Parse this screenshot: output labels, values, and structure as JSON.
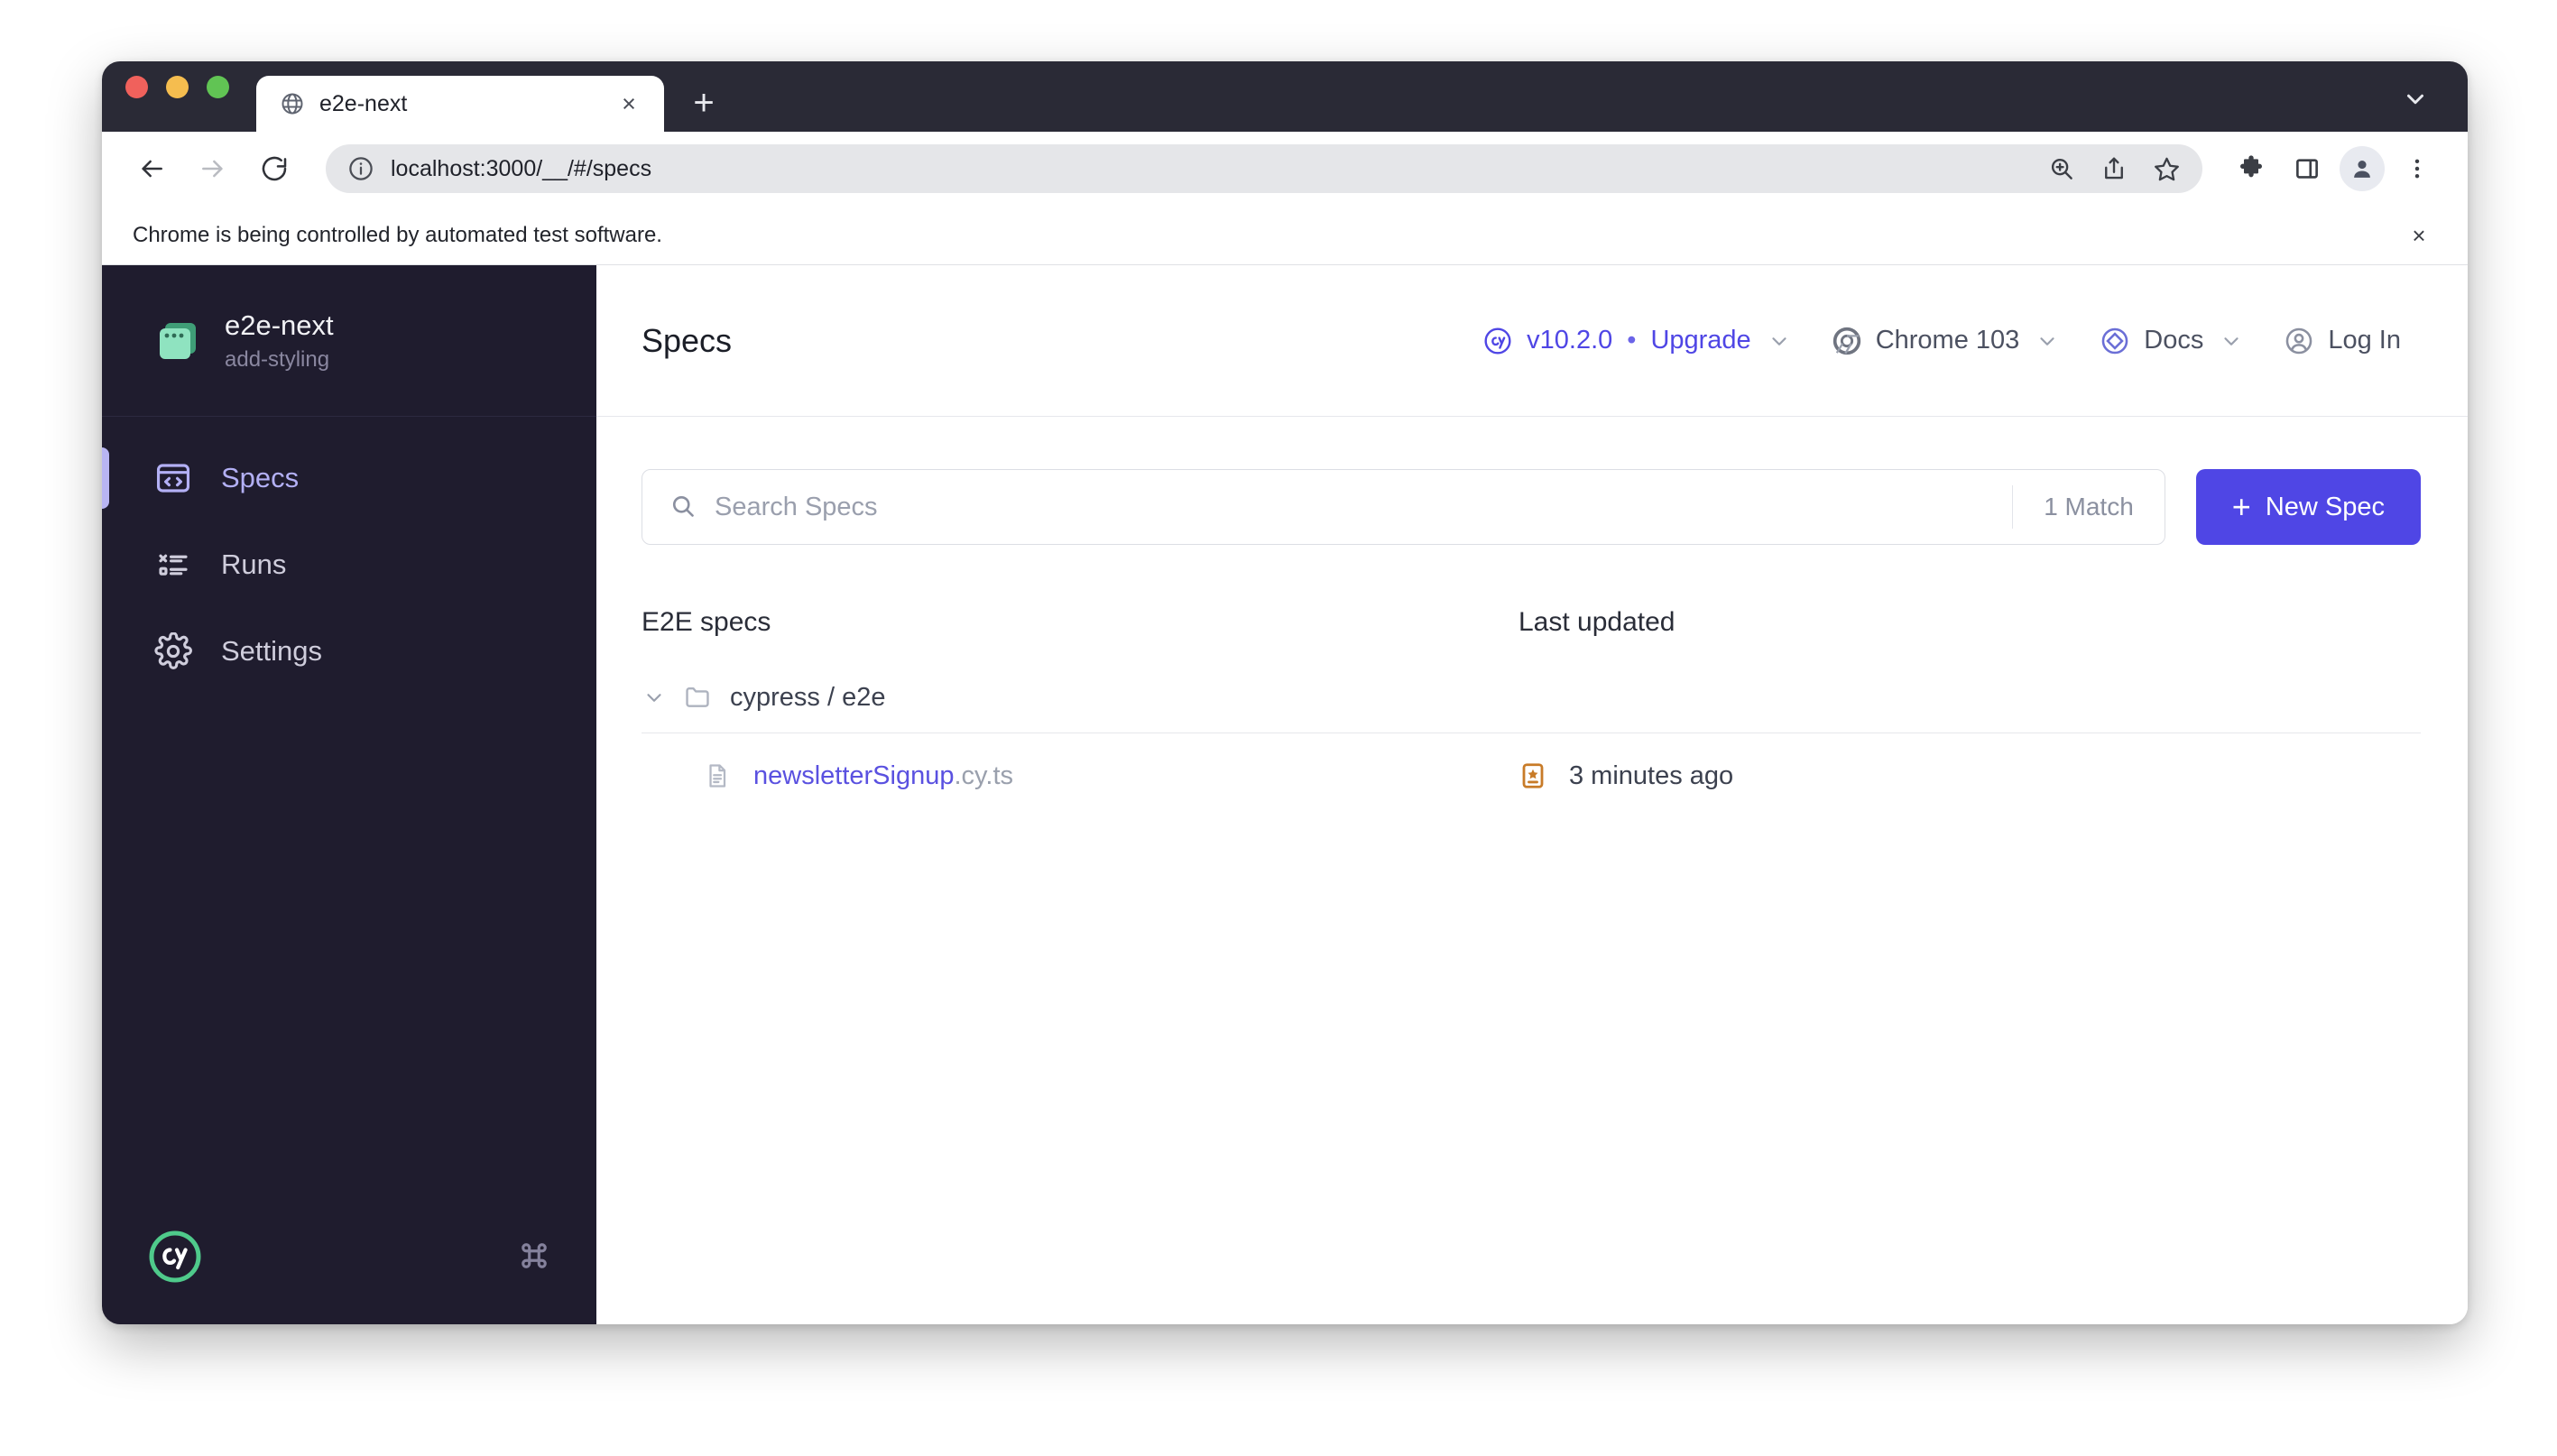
{
  "browser": {
    "tab": {
      "title": "e2e-next",
      "favicon": "globe-icon",
      "close": "×"
    },
    "new_tab_label": "+",
    "url_prefix": "localhost:3000",
    "url_suffix": "/__/#/specs",
    "full_url": "localhost:3000/__/#/specs",
    "infobar": {
      "message": "Chrome is being controlled by automated test software.",
      "close": "×"
    },
    "toolbar_icons": [
      "back-icon",
      "forward-icon",
      "reload-icon",
      "info-icon",
      "zoom-icon",
      "share-icon",
      "bookmark-star-icon",
      "extensions-puzzle-icon",
      "side-panel-icon",
      "profile-avatar-icon",
      "more-menu-icon"
    ]
  },
  "sidebar": {
    "project": {
      "name": "e2e-next",
      "branch": "add-styling",
      "icon": "project-window-icon"
    },
    "items": [
      {
        "label": "Specs",
        "icon": "specs-code-icon",
        "active": true
      },
      {
        "label": "Runs",
        "icon": "runs-list-icon",
        "active": false
      },
      {
        "label": "Settings",
        "icon": "settings-gear-icon",
        "active": false
      }
    ],
    "footer": {
      "logo": "cypress-logo-icon",
      "shortcut_icon": "command-key-icon",
      "shortcut_glyph": "⌘"
    }
  },
  "header": {
    "title": "Specs",
    "version": {
      "icon": "cypress-badge-icon",
      "version_label": "v10.2.0",
      "separator": "•",
      "upgrade_label": "Upgrade",
      "chevron": "⌄"
    },
    "browser_selector": {
      "icon": "chrome-icon",
      "label": "Chrome 103",
      "chevron": "⌄"
    },
    "docs": {
      "icon": "docs-icon",
      "label": "Docs",
      "chevron": "⌄"
    },
    "login": {
      "icon": "user-circle-icon",
      "label": "Log In"
    }
  },
  "search": {
    "placeholder": "Search Specs",
    "value": "",
    "icon": "search-icon",
    "match_count": "1 Match"
  },
  "new_spec": {
    "label": "New Spec",
    "plus": "+"
  },
  "spec_table": {
    "columns": {
      "name": "E2E specs",
      "updated": "Last updated"
    },
    "folder": {
      "label": "cypress / e2e",
      "expanded": true,
      "chevron_icon": "chevron-down-icon",
      "folder_icon": "folder-icon"
    },
    "rows": [
      {
        "name": "newsletterSignup",
        "extension": ".cy.ts",
        "file_icon": "spec-file-icon",
        "git_status_icon": "git-new-file-icon",
        "updated": "3 minutes ago"
      }
    ]
  },
  "colors": {
    "accent": "#4f46e5",
    "sidebar_bg": "#1f1c2e",
    "chrome_bg": "#2a2a36",
    "spec_link": "#5a51e0",
    "git_new": "#c87b28",
    "project_green": "#8fe3c0"
  }
}
